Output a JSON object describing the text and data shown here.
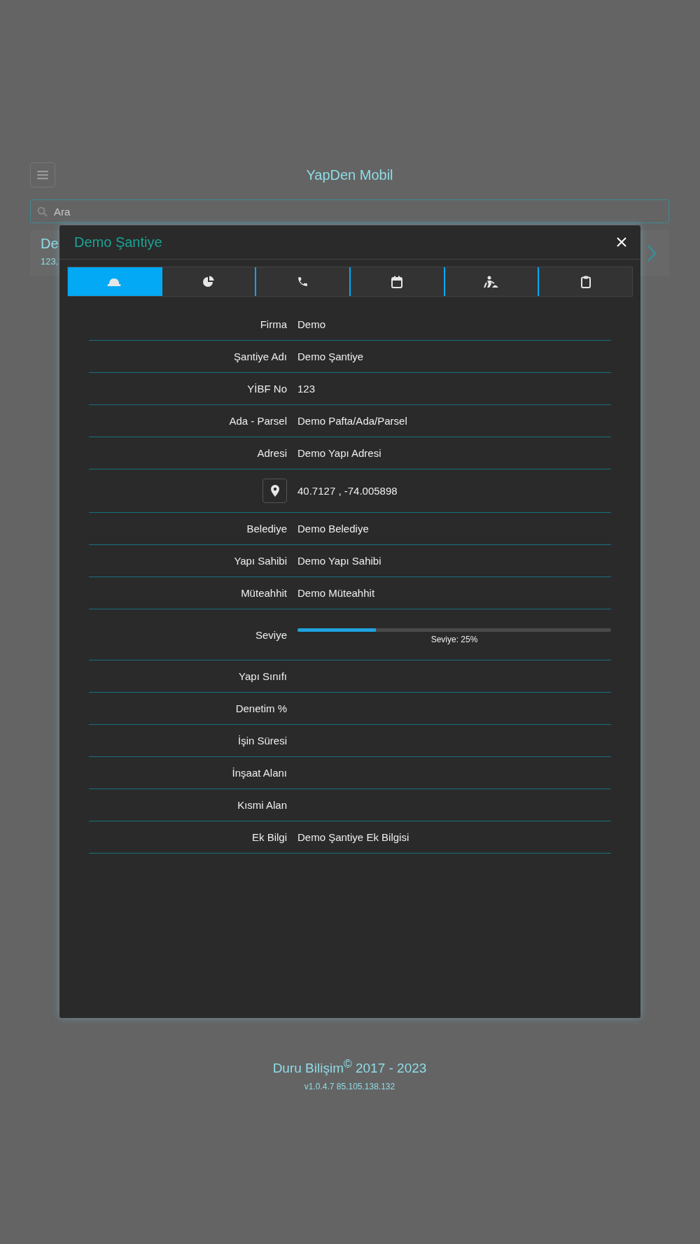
{
  "header": {
    "title": "YapDen Mobil"
  },
  "search": {
    "placeholder": "Ara"
  },
  "list_item": {
    "title": "De",
    "subtitle": "123,"
  },
  "modal": {
    "title": "Demo Şantiye",
    "tabs": [
      {
        "selected": true
      },
      {
        "selected": false
      },
      {
        "selected": false
      },
      {
        "selected": false
      },
      {
        "selected": false
      },
      {
        "selected": false
      }
    ],
    "rows": [
      {
        "kind": "text",
        "label": "Firma",
        "value": "Demo"
      },
      {
        "kind": "text",
        "label": "Şantiye Adı",
        "value": "Demo Şantiye"
      },
      {
        "kind": "text",
        "label": "YİBF No",
        "value": "123"
      },
      {
        "kind": "text",
        "label": "Ada - Parsel",
        "value": "Demo Pafta/Ada/Parsel"
      },
      {
        "kind": "text",
        "label": "Adresi",
        "value": "Demo Yapı Adresi"
      },
      {
        "kind": "location",
        "value": "40.7127 , -74.005898"
      },
      {
        "kind": "text",
        "label": "Belediye",
        "value": "Demo Belediye"
      },
      {
        "kind": "text",
        "label": "Yapı Sahibi",
        "value": "Demo Yapı Sahibi"
      },
      {
        "kind": "text",
        "label": "Müteahhit",
        "value": "Demo Müteahhit"
      },
      {
        "kind": "level",
        "label": "Seviye",
        "level": 0.25,
        "reading": "Seviye: 25%"
      },
      {
        "kind": "text",
        "label": "Yapı Sınıfı"
      },
      {
        "kind": "text",
        "label": "Denetim %"
      },
      {
        "kind": "text",
        "label": "İşin Süresi"
      },
      {
        "kind": "text",
        "label": "İnşaat Alanı"
      },
      {
        "kind": "text",
        "label": "Kısmi Alan"
      },
      {
        "kind": "text",
        "label": "Ek Bilgi",
        "value": "Demo Şantiye Ek Bilgisi"
      }
    ]
  },
  "footer": {
    "copyright": "Duru Bilişim$^{©}$ 2017 - 2023",
    "version": "v1.0.4.7 85.105.138.132"
  }
}
